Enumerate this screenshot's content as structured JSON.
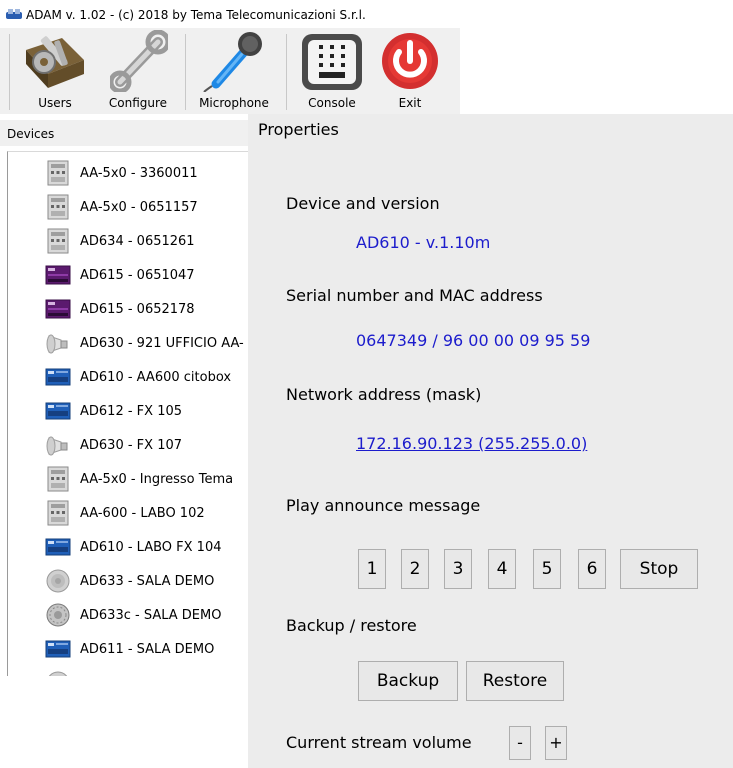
{
  "window": {
    "title": "ADAM v. 1.02 - (c) 2018 by Tema Telecomunicazioni S.r.l."
  },
  "toolbar": {
    "buttons": [
      {
        "label": "Users",
        "icon": "keys-on-book-icon"
      },
      {
        "label": "Configure",
        "icon": "wrench-icon"
      },
      {
        "label": "Microphone",
        "icon": "microphone-icon"
      },
      {
        "label": "Console",
        "icon": "console-panel-icon"
      },
      {
        "label": "Exit",
        "icon": "power-icon"
      }
    ]
  },
  "devices": {
    "header": "Devices",
    "items": [
      {
        "label": "AA-5x0 - 3360011",
        "icon": "intercom-panel-icon"
      },
      {
        "label": "AA-5x0 - 0651157",
        "icon": "intercom-panel-icon"
      },
      {
        "label": "AD634 - 0651261",
        "icon": "intercom-panel-icon"
      },
      {
        "label": "AD615 - 0651047",
        "icon": "purple-module-icon"
      },
      {
        "label": "AD615 - 0652178",
        "icon": "purple-module-icon"
      },
      {
        "label": "AD630 - 921 UFFICIO AA-",
        "icon": "horn-speaker-icon"
      },
      {
        "label": "AD610 - AA600 citobox",
        "icon": "blue-module-icon"
      },
      {
        "label": "AD612 - FX 105",
        "icon": "blue-module-icon"
      },
      {
        "label": "AD630 - FX 107",
        "icon": "horn-speaker-icon"
      },
      {
        "label": "AA-5x0 - Ingresso Tema",
        "icon": "intercom-panel-icon"
      },
      {
        "label": "AA-600 - LABO 102",
        "icon": "intercom-panel-icon"
      },
      {
        "label": "AD610 - LABO FX 104",
        "icon": "blue-module-icon"
      },
      {
        "label": "AD633 - SALA DEMO",
        "icon": "ceiling-speaker-icon"
      },
      {
        "label": "AD633c - SALA DEMO",
        "icon": "ceiling-speaker-icon"
      },
      {
        "label": "AD611 - SALA DEMO",
        "icon": "blue-module-icon"
      }
    ]
  },
  "properties": {
    "title": "Properties",
    "device_version_label": "Device and version",
    "device_version_value": "AD610 - v.1.10m",
    "serial_mac_label": "Serial number and MAC address",
    "serial_mac_value": "0647349 / 96 00 00 09 95 59",
    "network_label": "Network address (mask)",
    "network_value": "172.16.90.123 (255.255.0.0)",
    "announce_label": "Play announce message",
    "announce_buttons": [
      "1",
      "2",
      "3",
      "4",
      "5",
      "6"
    ],
    "stop_label": "Stop",
    "backup_section_label": "Backup / restore",
    "backup_label": "Backup",
    "restore_label": "Restore",
    "volume_label": "Current stream volume",
    "volume_down_label": "-",
    "volume_up_label": "+"
  },
  "colors": {
    "value_text": "#1c1ccc",
    "panel_bg": "#ececec"
  }
}
